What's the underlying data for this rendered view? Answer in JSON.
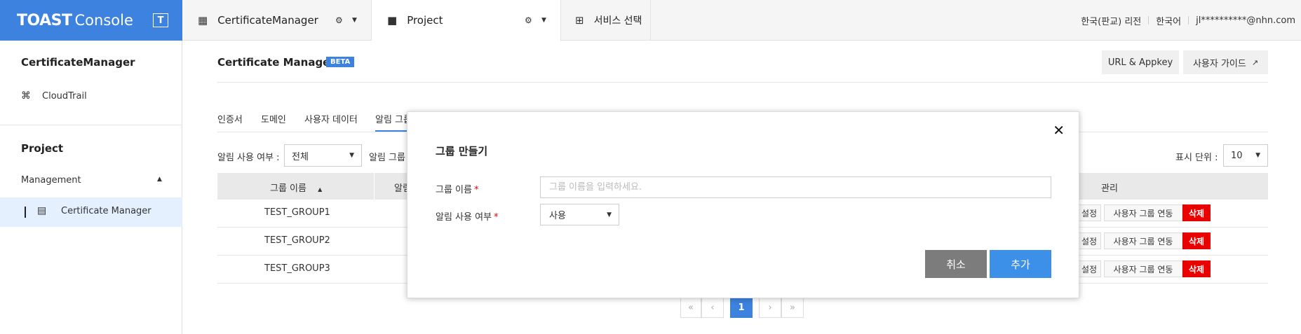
{
  "topbar": {
    "logo_brand": "TOAST",
    "logo_console": "Console",
    "logo_badge": "T",
    "tabs": [
      {
        "label": "CertificateManager"
      },
      {
        "label": "Project"
      },
      {
        "label": "서비스 선택"
      }
    ],
    "region": "한국(판교) 리전",
    "language": "한국어",
    "user": "jl**********@nhn.com"
  },
  "sidebar": {
    "section1_title": "CertificateManager",
    "cloudtrail_label": "CloudTrail",
    "section2_title": "Project",
    "group_label": "Management",
    "active_item_label": "Certificate Manager"
  },
  "main": {
    "title": "Certificate Manager",
    "badge": "BETA",
    "url_appkey_button": "URL & Appkey",
    "user_guide_button": "사용자 가이드",
    "tabs": [
      {
        "label": "인증서"
      },
      {
        "label": "도메인"
      },
      {
        "label": "사용자 데이터"
      },
      {
        "label": "알림 그룹"
      }
    ],
    "filter_label": "알림 사용 여부 :",
    "filter_value": "전체",
    "filter2_label": "알림 그룹",
    "page_size_label": "표시 단위 :",
    "page_size_value": "10",
    "columns": {
      "group_name": "그룹 이름",
      "notify": "알림",
      "manage": "관리"
    },
    "rows": [
      {
        "name": "TEST_GROUP1"
      },
      {
        "name": "TEST_GROUP2"
      },
      {
        "name": "TEST_GROUP3"
      }
    ],
    "row_actions": {
      "settings": "설정",
      "link_user_group": "사용자 그룹 연동",
      "delete": "삭제"
    },
    "pagination": {
      "first": "«",
      "prev": "‹",
      "current": "1",
      "next": "›",
      "last": "»"
    }
  },
  "modal": {
    "title": "그룹 만들기",
    "name_label": "그룹 이름",
    "name_placeholder": "그룹 이름을 입력하세요.",
    "notify_label": "알림 사용 여부",
    "notify_value": "사용",
    "required_mark": "*",
    "cancel_button": "취소",
    "add_button": "추가",
    "close_symbol": "✕"
  },
  "colors": {
    "accent": "#3c82de",
    "delete": "#e90000"
  }
}
